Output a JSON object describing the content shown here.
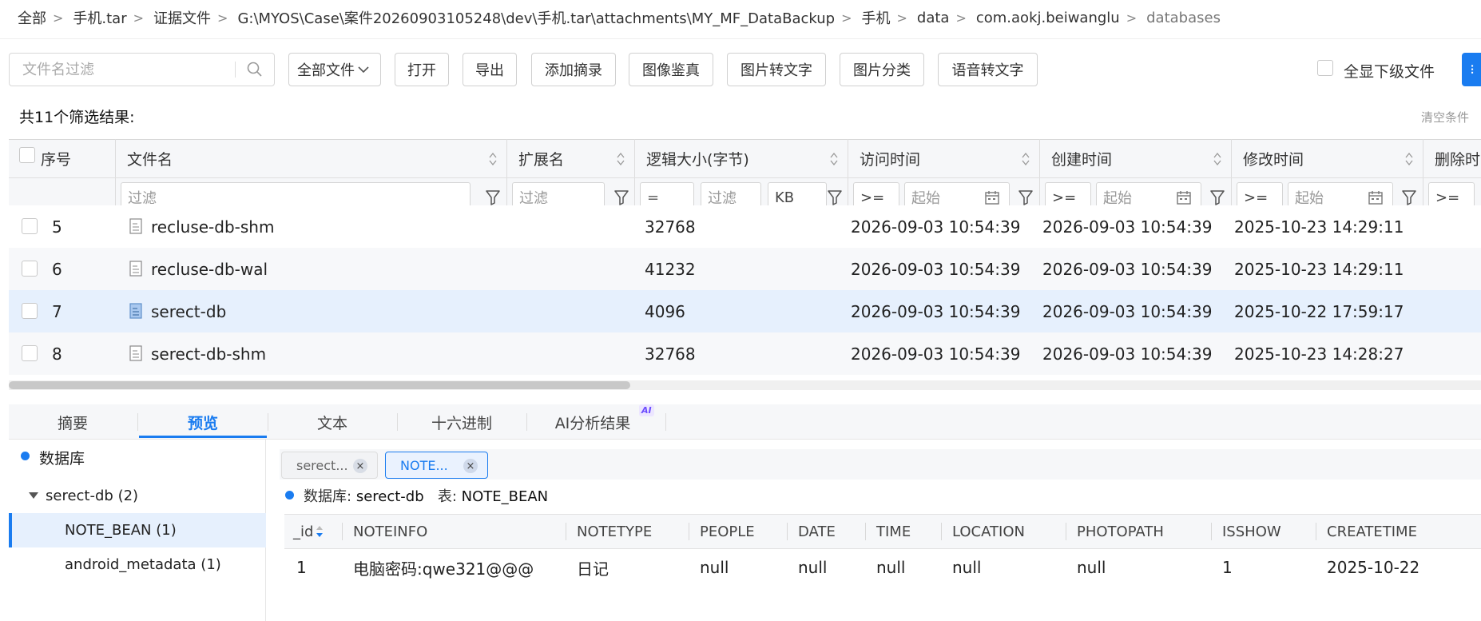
{
  "breadcrumb": [
    {
      "label": "全部"
    },
    {
      "label": "手机.tar"
    },
    {
      "label": "证据文件"
    },
    {
      "label": "G:\\MYOS\\Case\\案件20260903105248\\dev\\手机.tar\\attachments\\MY_MF_DataBackup"
    },
    {
      "label": "手机"
    },
    {
      "label": "data"
    },
    {
      "label": "com.aokj.beiwanglu"
    },
    {
      "label": "databases"
    }
  ],
  "toolbar": {
    "filter_placeholder": "文件名过滤",
    "all_files": "全部文件",
    "open": "打开",
    "export": "导出",
    "add_summary": "添加摘录",
    "image_check": "图像鉴真",
    "img_to_text": "图片转文字",
    "img_classify": "图片分类",
    "speech_to_text": "语音转文字",
    "show_all_sub": "全显下级文件"
  },
  "result_summary": "共11个筛选结果:",
  "clear_conditions": "清空条件",
  "table": {
    "headers": {
      "seq": "序号",
      "name": "文件名",
      "ext": "扩展名",
      "size": "逻辑大小(字节)",
      "access": "访问时间",
      "create": "创建时间",
      "modify": "修改时间",
      "delete": "删除时间"
    },
    "filters": {
      "placeholder": "过滤",
      "eq": "=",
      "ge": ">=",
      "unit": "KB",
      "start": "起始"
    },
    "rows": [
      {
        "seq": "5",
        "name": "recluse-db-shm",
        "ext": "",
        "size": "32768",
        "access": "2026-09-03 10:54:39",
        "create": "2026-09-03 10:54:39",
        "modify": "2025-10-23 14:29:11"
      },
      {
        "seq": "6",
        "name": "recluse-db-wal",
        "ext": "",
        "size": "41232",
        "access": "2026-09-03 10:54:39",
        "create": "2026-09-03 10:54:39",
        "modify": "2025-10-23 14:29:11"
      },
      {
        "seq": "7",
        "name": "serect-db",
        "ext": "",
        "size": "4096",
        "access": "2026-09-03 10:54:39",
        "create": "2026-09-03 10:54:39",
        "modify": "2025-10-22 17:59:17"
      },
      {
        "seq": "8",
        "name": "serect-db-shm",
        "ext": "",
        "size": "32768",
        "access": "2026-09-03 10:54:39",
        "create": "2026-09-03 10:54:39",
        "modify": "2025-10-23 14:28:27"
      }
    ],
    "selected_row": "7"
  },
  "bottom_tabs": [
    {
      "label": "摘要"
    },
    {
      "label": "预览"
    },
    {
      "label": "文本"
    },
    {
      "label": "十六进制"
    },
    {
      "label": "AI分析结果"
    }
  ],
  "ai_badge": "AI",
  "active_tab": "预览",
  "tree": {
    "root": "数据库",
    "db": "serect-db",
    "db_count": "(2)",
    "tables": [
      {
        "name": "NOTE_BEAN",
        "count": "(1)"
      },
      {
        "name": "android_metadata",
        "count": "(1)"
      }
    ]
  },
  "preview": {
    "tabs": [
      {
        "label": "serect..."
      },
      {
        "label": "NOTE..."
      }
    ],
    "close_glyph": "×",
    "db_label": "数据库:",
    "db_value": "serect-db",
    "table_label": "表:",
    "table_value": "NOTE_BEAN",
    "columns": [
      "_id",
      "NOTEINFO",
      "NOTETYPE",
      "PEOPLE",
      "DATE",
      "TIME",
      "LOCATION",
      "PHOTOPATH",
      "ISSHOW",
      "CREATETIME"
    ],
    "row": [
      "1",
      "电脑密码:qwe321@@@",
      "日记",
      "null",
      "null",
      "null",
      "null",
      "null",
      "1",
      "2025-10-22"
    ]
  },
  "colors": {
    "accent": "#1a7cf0",
    "selected_row": "#e6f0fd",
    "stripe": "#f7f8fa"
  }
}
